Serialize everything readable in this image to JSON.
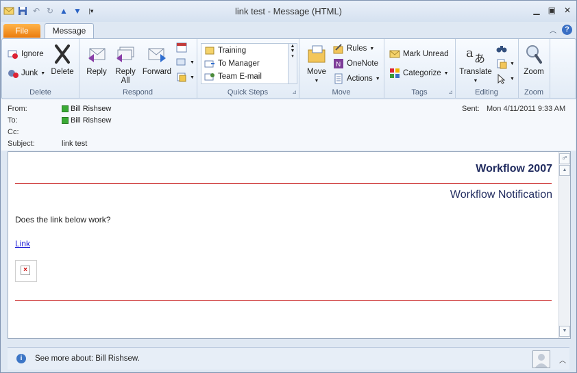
{
  "window": {
    "title": "link test  -  Message (HTML)"
  },
  "tabs": {
    "file": "File",
    "message": "Message"
  },
  "ribbon": {
    "delete_group": {
      "label": "Delete",
      "ignore": "Ignore",
      "junk": "Junk",
      "delete": "Delete"
    },
    "respond_group": {
      "label": "Respond",
      "reply": "Reply",
      "reply_all_1": "Reply",
      "reply_all_2": "All",
      "forward": "Forward"
    },
    "quick_steps_group": {
      "label": "Quick Steps",
      "items": [
        "Training",
        "To Manager",
        "Team E-mail"
      ]
    },
    "move_group": {
      "label": "Move",
      "move": "Move",
      "rules": "Rules",
      "onenote": "OneNote",
      "actions": "Actions"
    },
    "tags_group": {
      "label": "Tags",
      "mark_unread": "Mark Unread",
      "categorize": "Categorize"
    },
    "editing_group": {
      "label": "Editing",
      "translate": "Translate"
    },
    "zoom_group": {
      "label": "Zoom",
      "zoom": "Zoom"
    }
  },
  "header": {
    "from_label": "From:",
    "from_value": "Bill Rishsew",
    "to_label": "To:",
    "to_value": "Bill Rishsew",
    "cc_label": "Cc:",
    "subject_label": "Subject:",
    "subject_value": "link test",
    "sent_label": "Sent:",
    "sent_value": "Mon 4/11/2011 9:33 AM"
  },
  "message": {
    "title": "Workflow 2007",
    "subtitle": "Workflow Notification",
    "question": "Does the link below work?",
    "link": "Link"
  },
  "footer": {
    "see_more": "See more about: Bill Rishsew."
  },
  "colors": {
    "accent_file_tab": "#ea7b0c",
    "rule": "#c00000",
    "heading": "#1f2a5e",
    "link": "#1a1ad6"
  }
}
